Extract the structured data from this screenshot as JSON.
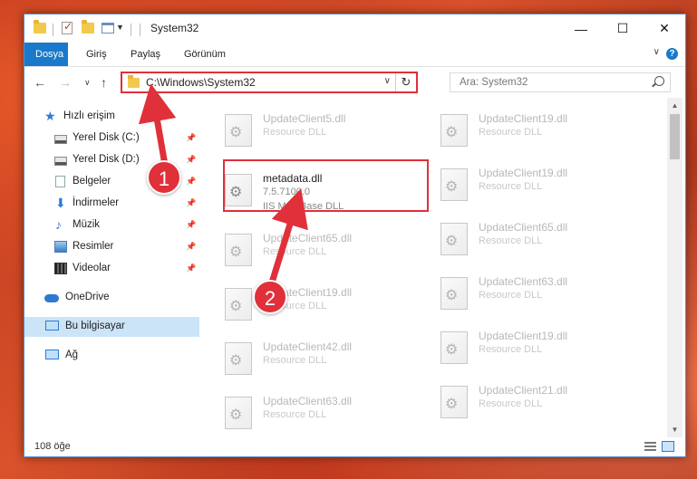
{
  "window": {
    "title": "System32",
    "minimize": "—",
    "maximize": "☐",
    "close": "✕"
  },
  "ribbon": {
    "tabs": [
      "Dosya",
      "Giriş",
      "Paylaş",
      "Görünüm"
    ],
    "help": "?"
  },
  "address": {
    "path": "C:\\Windows\\System32",
    "search_placeholder": "Ara: System32"
  },
  "sidebar": {
    "items": [
      {
        "label": "Hızlı erişim",
        "icon": "star-icon",
        "pinned": false
      },
      {
        "label": "Yerel Disk (C:)",
        "icon": "drive-icon",
        "pinned": true
      },
      {
        "label": "Yerel Disk (D:)",
        "icon": "drive-icon",
        "pinned": true
      },
      {
        "label": "Belgeler",
        "icon": "document-icon",
        "pinned": true
      },
      {
        "label": "İndirmeler",
        "icon": "download-icon",
        "pinned": true
      },
      {
        "label": "Müzik",
        "icon": "music-icon",
        "pinned": true
      },
      {
        "label": "Resimler",
        "icon": "pictures-icon",
        "pinned": true
      },
      {
        "label": "Videolar",
        "icon": "video-icon",
        "pinned": true
      },
      {
        "label": "OneDrive",
        "icon": "cloud-icon",
        "pinned": false
      },
      {
        "label": "Bu bilgisayar",
        "icon": "computer-icon",
        "pinned": false,
        "selected": true
      },
      {
        "label": "Ağ",
        "icon": "network-icon",
        "pinned": false
      }
    ]
  },
  "files": {
    "left": [
      {
        "name": "UpdateClient5.dll",
        "type": "Resource DLL"
      },
      {
        "name": "metadata.dll",
        "size": "7.5.7100.0",
        "type": "IIS MetaBase DLL",
        "selected": true
      },
      {
        "name": "UpdateClient65.dll",
        "type": "Resource DLL"
      },
      {
        "name": "UpdateClient19.dll",
        "type": "Resource DLL"
      },
      {
        "name": "UpdateClient42.dll",
        "type": "Resource DLL"
      },
      {
        "name": "UpdateClient63.dll",
        "type": "Resource DLL"
      }
    ],
    "right": [
      {
        "name": "UpdateClient19.dll",
        "type": "Resource DLL"
      },
      {
        "name": "UpdateClient19.dll",
        "type": "Resource DLL"
      },
      {
        "name": "UpdateClient65.dll",
        "type": "Resource DLL"
      },
      {
        "name": "UpdateClient63.dll",
        "type": "Resource DLL"
      },
      {
        "name": "UpdateClient19.dll",
        "type": "Resource DLL"
      },
      {
        "name": "UpdateClient21.dll",
        "type": "Resource DLL"
      }
    ]
  },
  "status": {
    "item_count": "108 öğe"
  },
  "annotations": {
    "step1": "1",
    "step2": "2",
    "color": "#e0303a"
  }
}
